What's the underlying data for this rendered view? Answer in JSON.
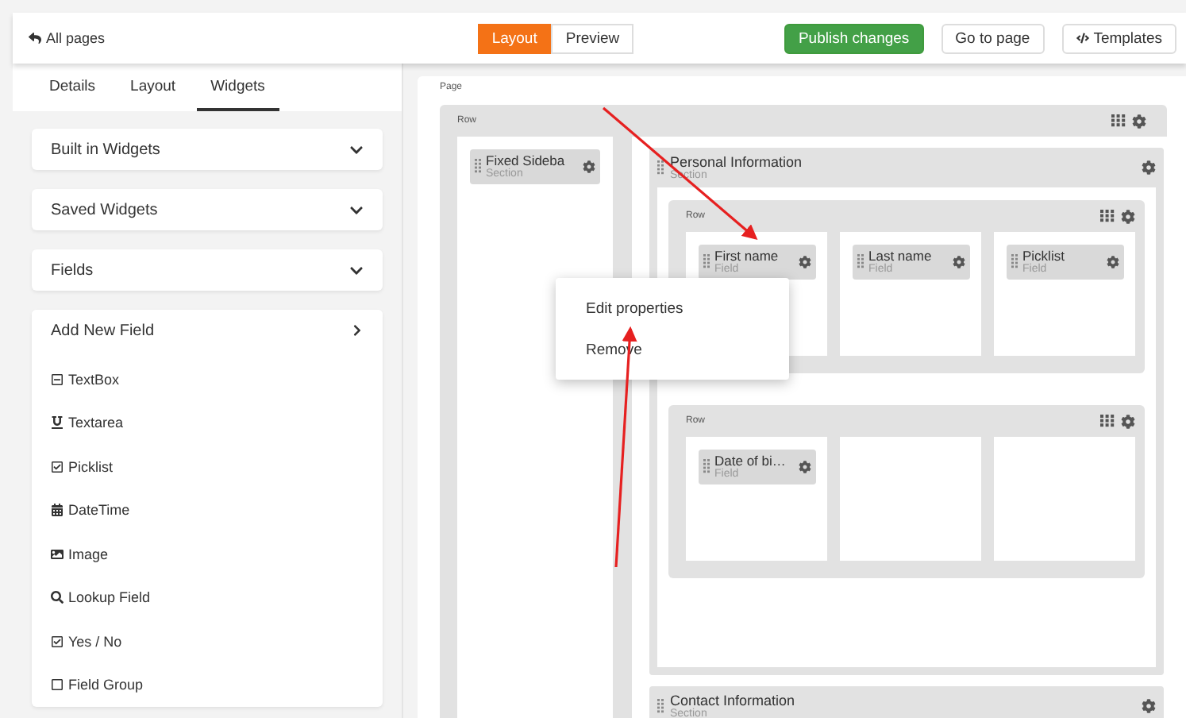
{
  "topbar": {
    "back_link": "All pages",
    "mode_tabs": [
      {
        "label": "Layout",
        "selected": true
      },
      {
        "label": "Preview",
        "selected": false
      }
    ],
    "buttons": [
      {
        "label": "Publish changes",
        "kind": "primary"
      },
      {
        "label": "Go to page",
        "kind": "plain"
      },
      {
        "label": "Templates",
        "kind": "code"
      }
    ]
  },
  "sidebar": {
    "tabs": [
      {
        "label": "Details",
        "selected": false
      },
      {
        "label": "Layout",
        "selected": false
      },
      {
        "label": "Widgets",
        "selected": true
      }
    ],
    "panels": [
      {
        "label": "Built in Widgets",
        "kind": "collapse"
      },
      {
        "label": "Saved Widgets",
        "kind": "collapse"
      },
      {
        "label": "Fields",
        "kind": "collapse"
      }
    ],
    "add_new_field": {
      "title": "Add New Field",
      "items": [
        {
          "label": "TextBox",
          "kind": "textbox"
        },
        {
          "label": "Textarea",
          "kind": "textarea"
        },
        {
          "label": "Picklist",
          "kind": "check"
        },
        {
          "label": "DateTime",
          "kind": "calendar"
        },
        {
          "label": "Image",
          "kind": "image"
        },
        {
          "label": "Lookup Field",
          "kind": "search"
        },
        {
          "label": "Yes / No",
          "kind": "check"
        },
        {
          "label": "Field Group",
          "kind": "group"
        }
      ]
    }
  },
  "canvas": {
    "label": "Page",
    "row": {
      "label": "Row",
      "sidebar_widget": {
        "title": "Fixed Sideba",
        "subtitle": "Section"
      },
      "sections": [
        {
          "title": "Personal Information",
          "subtitle": "Section",
          "rows": [
            {
              "label": "Row",
              "cells": [
                [
                  {
                    "title": "First name",
                    "subtitle": "Field"
                  }
                ],
                [
                  {
                    "title": "Last name",
                    "subtitle": "Field"
                  }
                ],
                [
                  {
                    "title": "Picklist",
                    "subtitle": "Field"
                  }
                ]
              ]
            },
            {
              "label": "Row",
              "cells": [
                [
                  {
                    "title": "Date of bi…",
                    "subtitle": "Field"
                  }
                ],
                [],
                []
              ]
            }
          ]
        },
        {
          "title": "Contact Information",
          "subtitle": "Section"
        }
      ]
    }
  },
  "context_menu": {
    "items": [
      "Edit properties",
      "Remove"
    ]
  }
}
